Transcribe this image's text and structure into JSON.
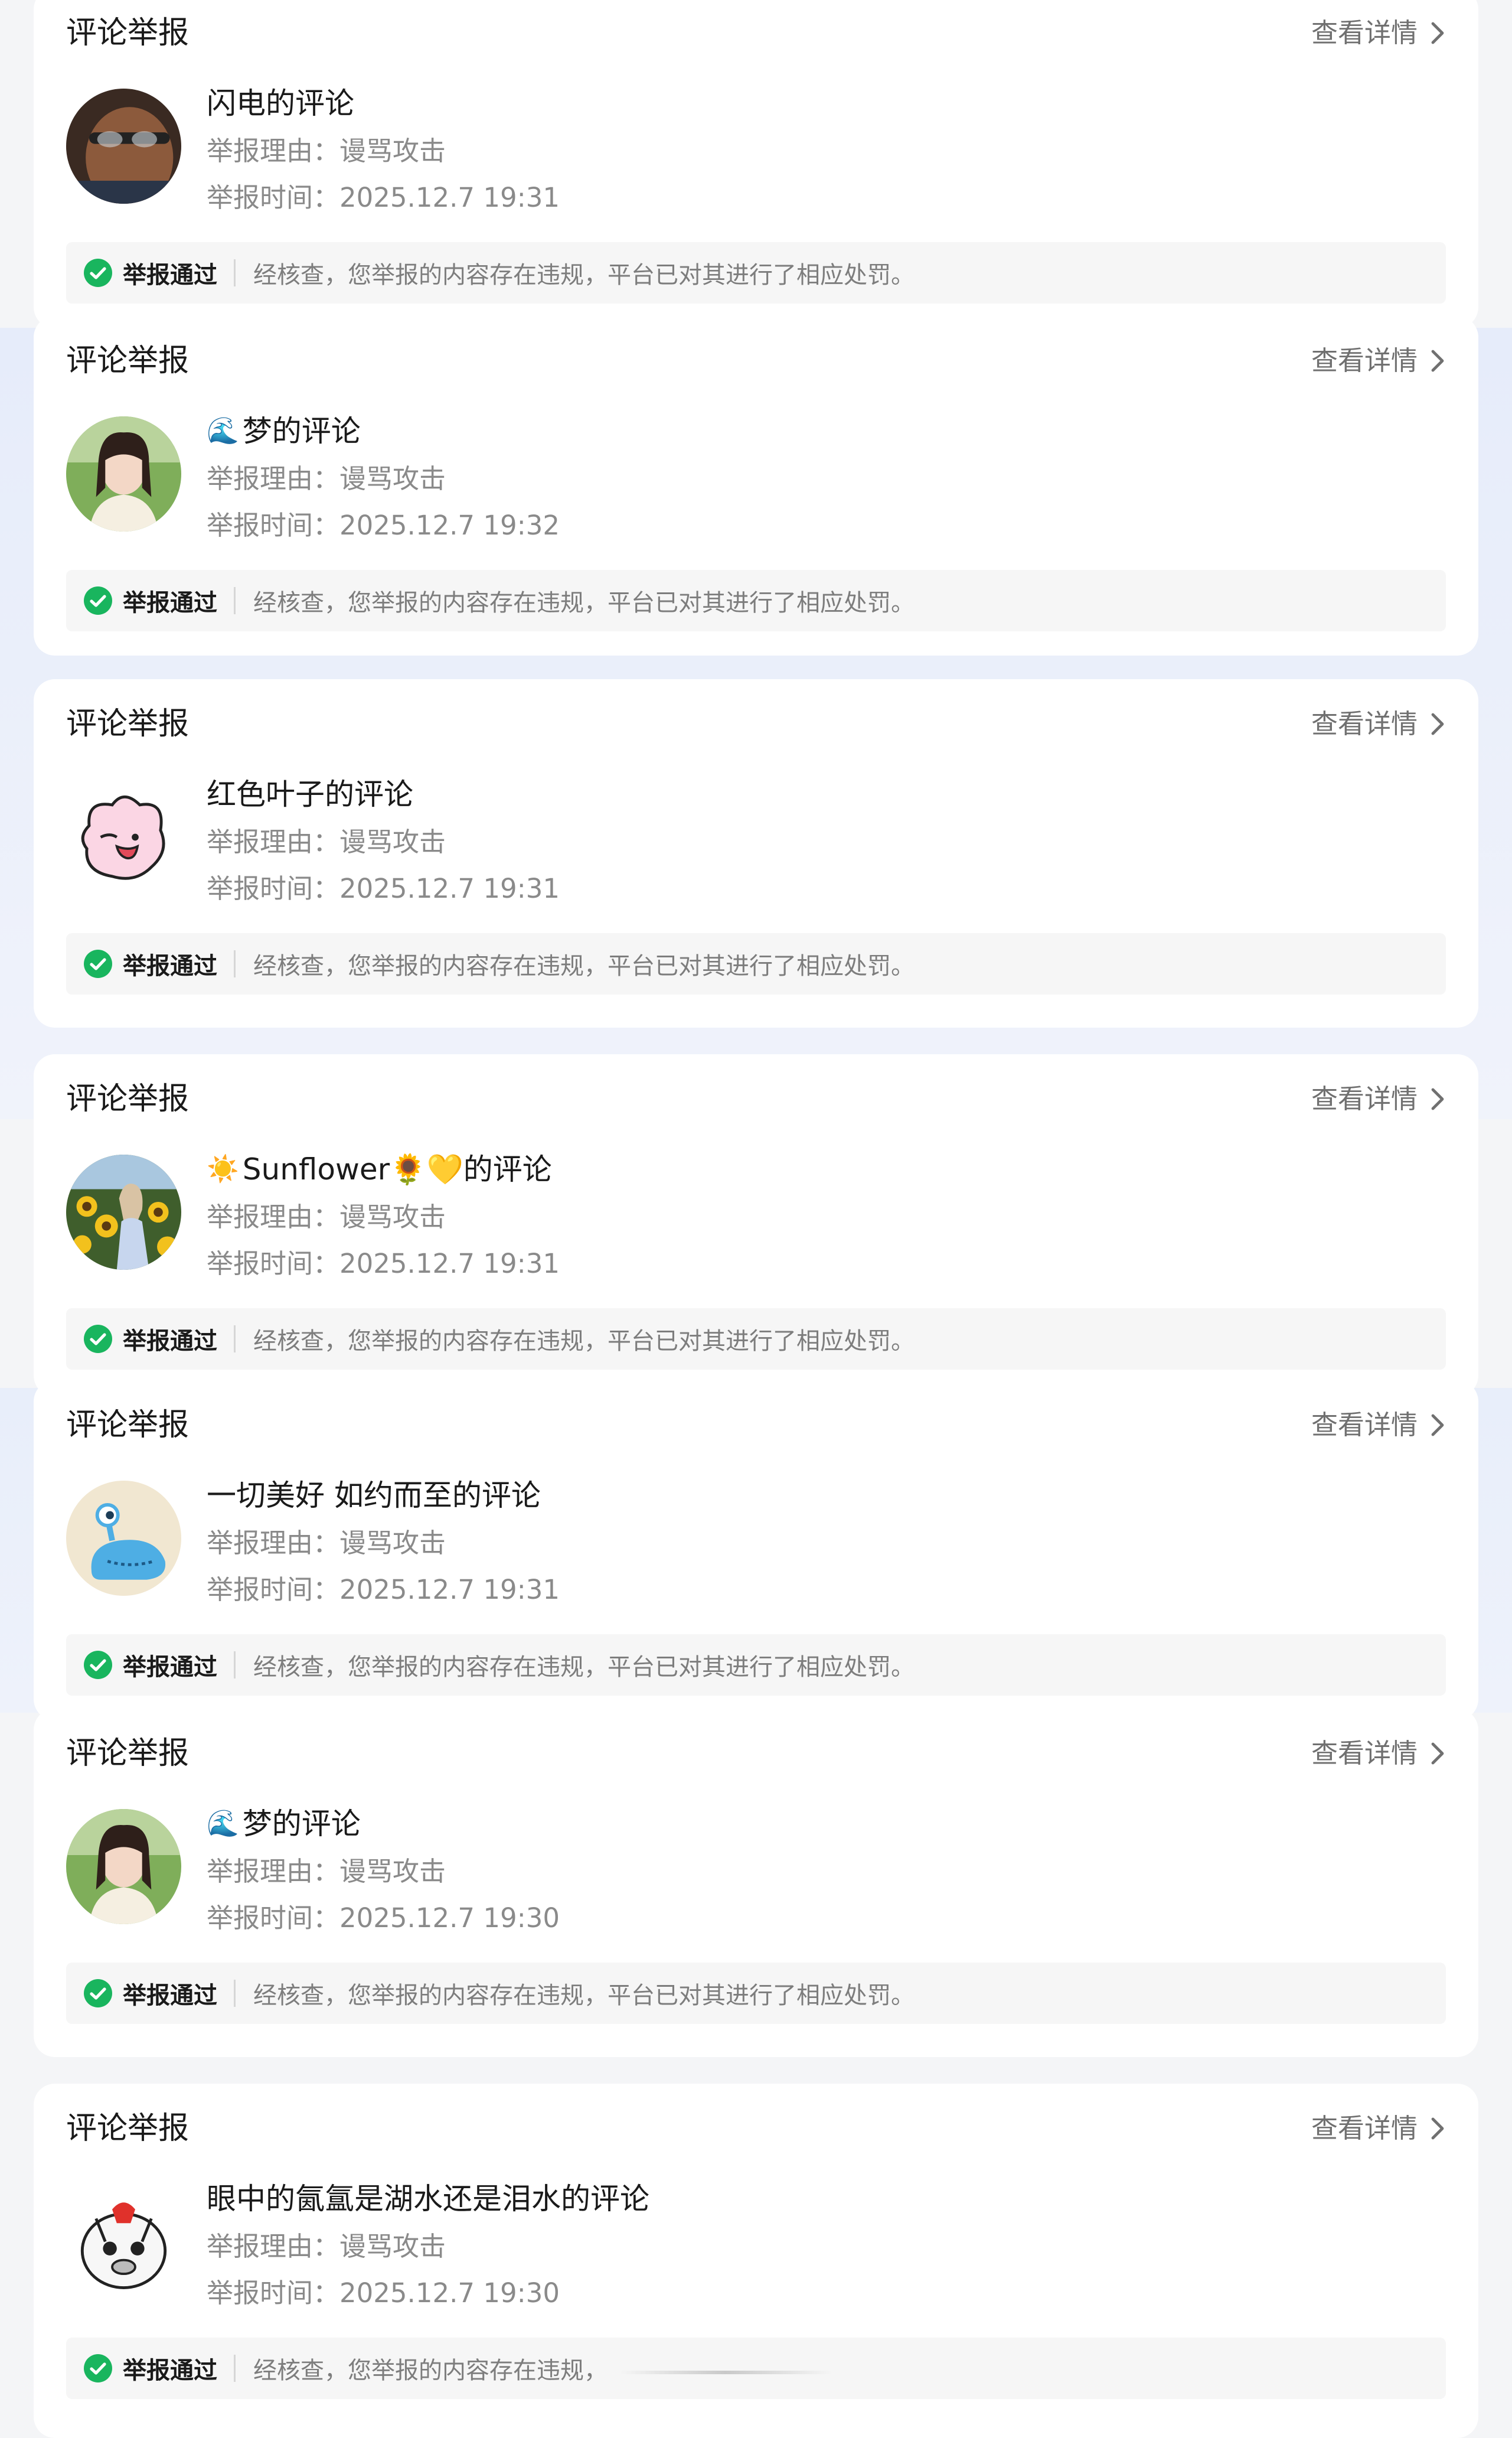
{
  "colors": {
    "background": "#f4f5f7",
    "card": "#ffffff",
    "band": "#e6ecfa",
    "status_bg": "#f6f6f6",
    "check_green": "#19b55e"
  },
  "reports": [
    {
      "title": "评论举报",
      "detail_label": "查看详情",
      "avatar": "man-photo",
      "name_prefix": "",
      "name": "闪电的评论",
      "reason": "举报理由：谩骂攻击",
      "time": "举报时间：2025.12.7 19:31",
      "status_label": "举报通过",
      "status_message": "经核查，您举报的内容存在违规，平台已对其进行了相应处罚。"
    },
    {
      "title": "评论举报",
      "detail_label": "查看详情",
      "avatar": "woman-field-photo",
      "name_prefix": "🌊",
      "name": "梦的评论",
      "reason": "举报理由：谩骂攻击",
      "time": "举报时间：2025.12.7 19:32",
      "status_label": "举报通过",
      "status_message": "经核查，您举报的内容存在违规，平台已对其进行了相应处罚。"
    },
    {
      "title": "评论举报",
      "detail_label": "查看详情",
      "avatar": "pink-cartoon",
      "name_prefix": "",
      "name": "红色叶子的评论",
      "reason": "举报理由：谩骂攻击",
      "time": "举报时间：2025.12.7 19:31",
      "status_label": "举报通过",
      "status_message": "经核查，您举报的内容存在违规，平台已对其进行了相应处罚。"
    },
    {
      "title": "评论举报",
      "detail_label": "查看详情",
      "avatar": "sunflower-photo",
      "name_prefix": "☀️",
      "name": "Sunflower🌻💛的评论",
      "reason": "举报理由：谩骂攻击",
      "time": "举报时间：2025.12.7 19:31",
      "status_label": "举报通过",
      "status_message": "经核查，您举报的内容存在违规，平台已对其进行了相应处罚。"
    },
    {
      "title": "评论举报",
      "detail_label": "查看详情",
      "avatar": "blue-creature-cartoon",
      "name_prefix": "",
      "name": "一切美好 如约而至的评论",
      "reason": "举报理由：谩骂攻击",
      "time": "举报时间：2025.12.7 19:31",
      "status_label": "举报通过",
      "status_message": "经核查，您举报的内容存在违规，平台已对其进行了相应处罚。"
    },
    {
      "title": "评论举报",
      "detail_label": "查看详情",
      "avatar": "woman-field-photo",
      "name_prefix": "🌊",
      "name": "梦的评论",
      "reason": "举报理由：谩骂攻击",
      "time": "举报时间：2025.12.7 19:30",
      "status_label": "举报通过",
      "status_message": "经核查，您举报的内容存在违规，平台已对其进行了相应处罚。"
    },
    {
      "title": "评论举报",
      "detail_label": "查看详情",
      "avatar": "white-cartoon",
      "name_prefix": "",
      "name": "眼中的氤氲是湖水还是泪水的评论",
      "reason": "举报理由：谩骂攻击",
      "time": "举报时间：2025.12.7 19:30",
      "status_label": "举报通过",
      "status_message": "经核查，您举报的内容存在违规，"
    }
  ]
}
